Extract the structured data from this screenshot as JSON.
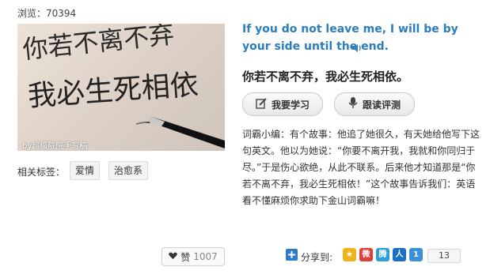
{
  "stats": {
    "views_label": "浏览：",
    "views_value": "70394"
  },
  "photo": {
    "watermark": "by超级院院手写稿",
    "line1": "你若不离不弃",
    "line2": "我必生死相依"
  },
  "tags": {
    "label": "相关标签：",
    "items": [
      "爱情",
      "治愈系"
    ]
  },
  "sentence": {
    "english": "If you do not leave me, I will be by your side until the end.",
    "chinese": "你若不离不弃，我必生死相依。"
  },
  "buttons": {
    "learn": "我要学习",
    "follow": "跟读评测"
  },
  "story": "词霸小编：有个故事：他追了她很久，有天她给他写下这句英文。他以为她说：“你要不离开我，我就和你同归于尽。”于是伤心欲绝，从此不联系。后来他才知道那是“你若不离不弃，我必生死相依！”这个故事告诉我们：英语看不懂麻烦你求助下金山词霸嘛！",
  "like": {
    "label": "赞",
    "count": "1007"
  },
  "share": {
    "label": "分享到:",
    "count": "13",
    "icons": [
      {
        "name": "qzone-icon",
        "color": "#f2b21c",
        "glyph": "★"
      },
      {
        "name": "weibo-icon",
        "color": "#e0403a",
        "glyph": "微"
      },
      {
        "name": "tencent-weibo-icon",
        "color": "#2a9fd8",
        "glyph": "腾"
      },
      {
        "name": "renren-icon",
        "color": "#1c6fc6",
        "glyph": "人"
      },
      {
        "name": "kaixin-icon",
        "color": "#3a8fd9",
        "glyph": "1"
      }
    ]
  }
}
